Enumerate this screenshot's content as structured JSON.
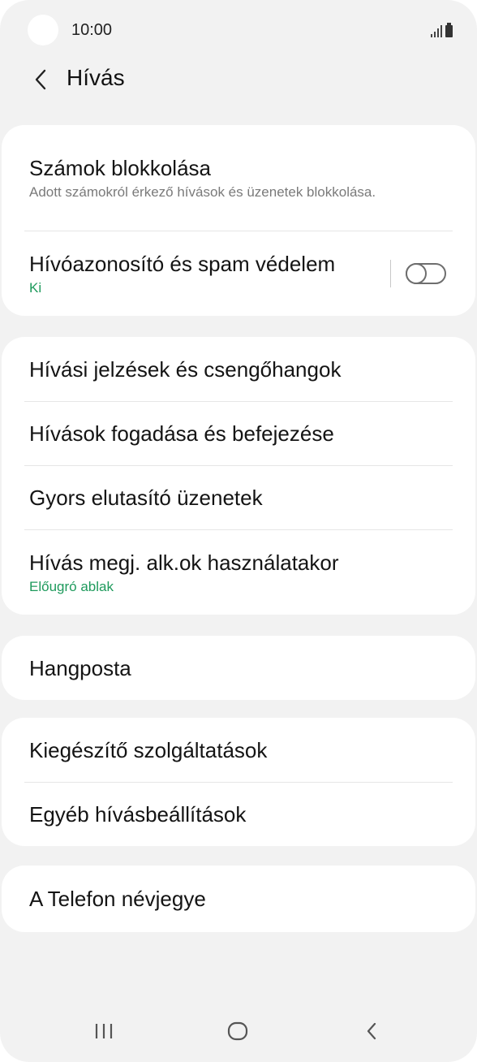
{
  "status_bar": {
    "time": "10:00"
  },
  "header": {
    "back_icon": "chevron-left-icon",
    "title": "Hívás"
  },
  "groups": [
    {
      "items": [
        {
          "title": "Számok blokkolása",
          "subtitle": "Adott számokról érkező hívások és üzenetek blokkolása."
        },
        {
          "title": "Hívóazonosító és spam védelem",
          "status": "Ki",
          "toggle_on": false
        }
      ]
    },
    {
      "items": [
        {
          "title": "Hívási jelzések és csengőhangok"
        },
        {
          "title": "Hívások fogadása és befejezése"
        },
        {
          "title": "Gyors elutasító üzenetek"
        },
        {
          "title": "Hívás megj. alk.ok használatakor",
          "status": "Előugró ablak"
        }
      ]
    },
    {
      "items": [
        {
          "title": "Hangposta"
        }
      ]
    },
    {
      "items": [
        {
          "title": "Kiegészítő szolgáltatások"
        },
        {
          "title": "Egyéb hívásbeállítások"
        }
      ]
    },
    {
      "items": [
        {
          "title": "A Telefon névjegye"
        }
      ]
    }
  ],
  "nav_bar": {
    "recents_icon": "recent-apps-icon",
    "home_icon": "home-icon",
    "back_icon": "back-nav-icon"
  },
  "colors": {
    "accent": "#1e9a5c",
    "background": "#f2f2f2",
    "card": "#ffffff"
  }
}
